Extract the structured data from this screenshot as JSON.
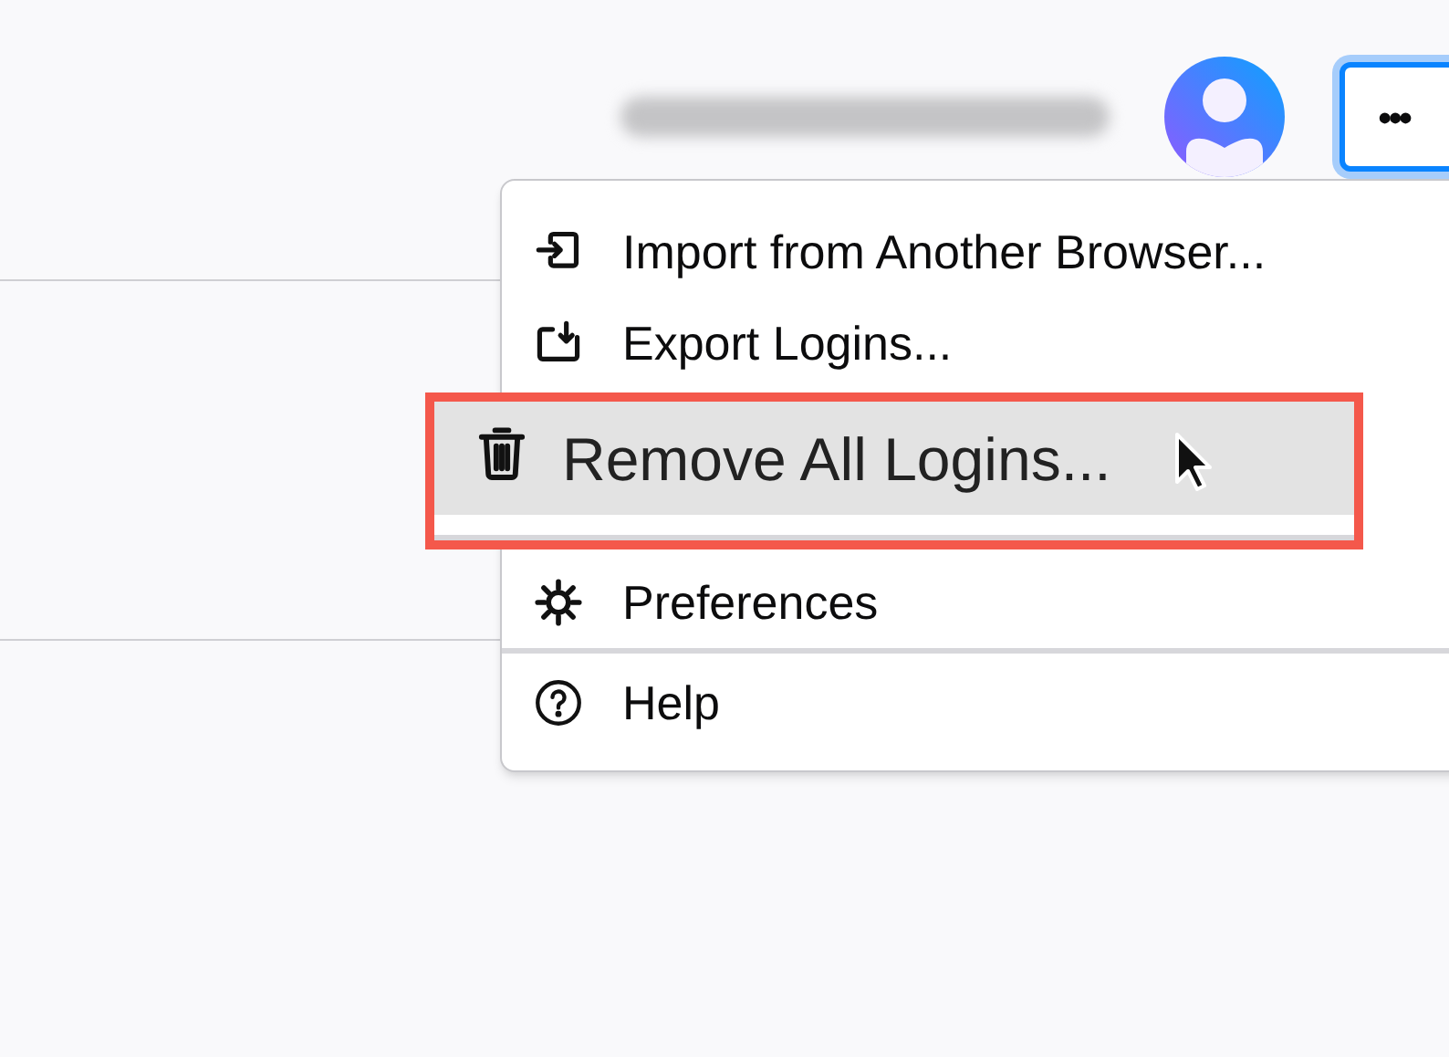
{
  "menu": {
    "sections": [
      {
        "items": [
          {
            "label": "Import from Another Browser...",
            "selected": false
          },
          {
            "label": "Export Logins...",
            "selected": false
          },
          {
            "label": "Remove All Logins...",
            "selected": true
          }
        ]
      },
      {
        "items": [
          {
            "label": "Preferences",
            "selected": false
          }
        ]
      },
      {
        "items": [
          {
            "label": "Help",
            "selected": false
          }
        ]
      }
    ]
  },
  "menu_button": {
    "label": "•••",
    "focused": true
  }
}
